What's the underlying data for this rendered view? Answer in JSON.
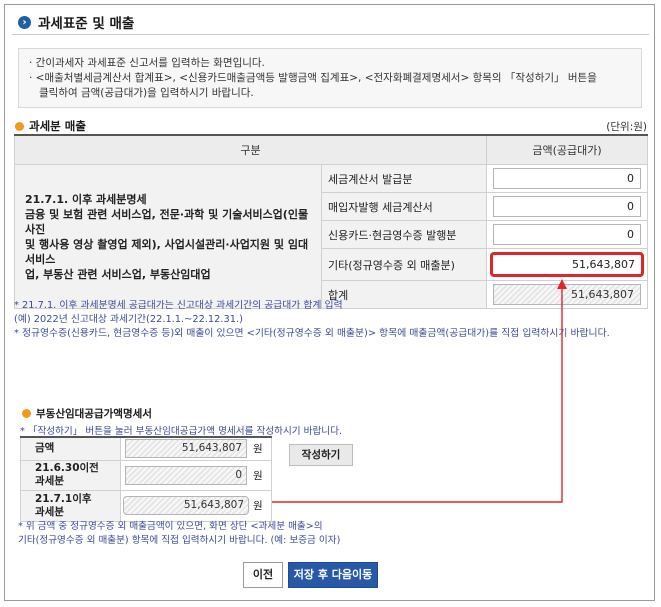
{
  "header": {
    "title": "과세표준 및 매출"
  },
  "info_lines": [
    "· 간이과세자 과세표준 신고서를 입력하는 화면입니다.",
    "· <매출처별세금계산서 합계표>, <신용카드매출금액등 발행금액 집계표>, <전자화폐결제명세서> 항목의 「작성하기」 버튼을",
    "  클릭하여 금액(공급대가)을 입력하시기 바랍니다."
  ],
  "sales_section": {
    "title": "과세분 매출",
    "unit": "(단위:원)",
    "col_division": "구분",
    "col_amount": "금액(공급대가)",
    "category_lines": [
      "21.7.1. 이후 과세분명세",
      "금융 및 보험 관련 서비스업, 전문·과학 및 기술서비스업(인물사진",
      "및 행사용 영상 촬영업 제외), 사업시설관리·사업지원 및 임대서비스",
      "업, 부동산 관련 서비스업, 부동산임대업"
    ],
    "rows": [
      {
        "label": "세금계산서 발급분",
        "value": "0"
      },
      {
        "label": "매입자발행 세금계산서",
        "value": "0"
      },
      {
        "label": "신용카드·현금영수증 발행분",
        "value": "0"
      },
      {
        "label": "기타(정규영수증 외 매출분)",
        "value": "51,643,807"
      }
    ],
    "total_label": "합계",
    "total_value": "51,643,807"
  },
  "notes": [
    "* 21.7.1. 이후 과세분명세 공급대가는 신고대상 과세기간의 공급대가 합계 입력",
    "  (예) 2022년 신고대상 과세기간(22.1.1.~22.12.31.)",
    "* 정규영수증(신용카드, 현금영수증 등)외 매출이 있으면 <기타(정규영수증 외 매출분)> 항목에 매출금액(공급대가)를 직접 입력하시기 바랍니다."
  ],
  "rent_section": {
    "title": "부동산임대공급가액명세서",
    "note": "* 「작성하기」 버튼을 눌러 부동산임대공급가액 명세서를 작성하시기 바랍니다.",
    "write_button": "작성하기",
    "currency": "원",
    "rows": [
      {
        "label_lines": [
          "금액"
        ],
        "value": "51,643,807"
      },
      {
        "label_lines": [
          "21.6.30이전",
          "과세분"
        ],
        "value": "0"
      },
      {
        "label_lines": [
          "21.7.1이후",
          "과세분"
        ],
        "value": "51,643,807"
      }
    ]
  },
  "bottom_notes": [
    "* 위 금액 중 정규영수증 외 매출금액이 있으면, 화면 상단 <과세분 매출>의",
    "  기타(정규영수증 외 매출분) 항목에 직접 입력하시기 바랍니다. (예: 보증금 이자)"
  ],
  "buttons": {
    "prev": "이전",
    "save_next": "저장 후 다음이동"
  },
  "colors": {
    "highlight_red": "#e0262b",
    "primary_blue": "#2759a8",
    "note_blue": "#3c4a96",
    "section_dot": "#f29a1e"
  }
}
